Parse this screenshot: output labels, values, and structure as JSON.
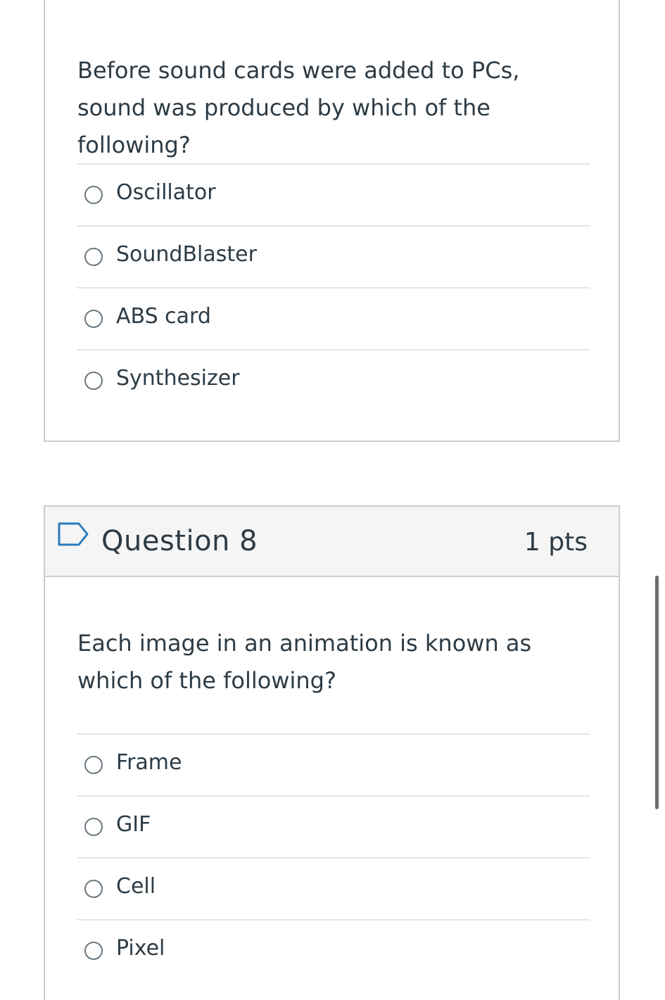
{
  "question7": {
    "text": "Before sound cards were added to PCs, sound was produced by which of the following?",
    "answers": [
      {
        "label": "Oscillator"
      },
      {
        "label": "SoundBlaster"
      },
      {
        "label": "ABS card"
      },
      {
        "label": "Synthesizer"
      }
    ]
  },
  "question8": {
    "title": "Question 8",
    "points": "1 pts",
    "text": "Each image in an animation is known as which of the following?",
    "answers": [
      {
        "label": "Frame"
      },
      {
        "label": "GIF"
      },
      {
        "label": "Cell"
      },
      {
        "label": "Pixel"
      }
    ]
  },
  "icons": {
    "flag": "flag-question-icon",
    "radio": "radio-button-icon"
  },
  "colors": {
    "text": "#2d3b45",
    "border": "#c7cdd1",
    "header_bg": "#f5f5f5",
    "flag": "#2b7abc"
  }
}
